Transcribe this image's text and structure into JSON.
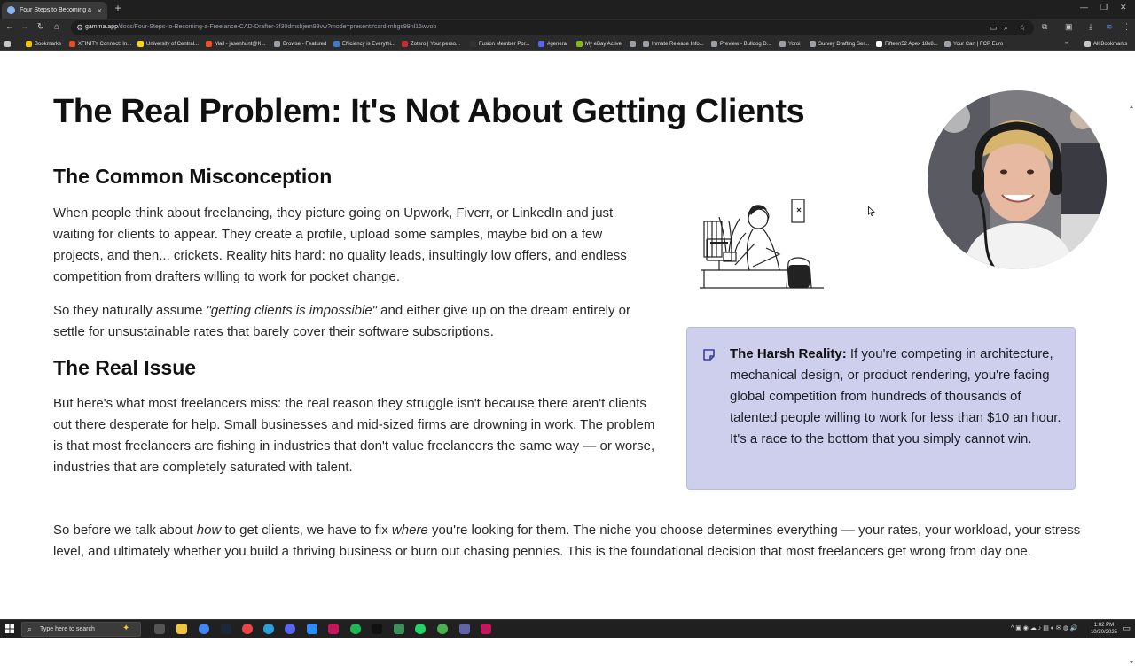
{
  "browser": {
    "tab_title": "Four Steps to Becoming a Freel",
    "tab_close": "×",
    "new_tab": "+",
    "url_host": "gamma.app",
    "url_path": "/docs/Four-Steps-to-Becoming-a-Freelance-CAD-Drafter-3f30dmsbjem93vw?mode=present#card-mhgs99nl16wvob",
    "all_bookmarks": "All Bookmarks",
    "bookmarks": [
      "Bookmarks",
      "XFINITY Connect: In...",
      "University of Central...",
      "Mail - jasenhunt@K...",
      "Browse - Featured",
      "Efficiency is Everythi...",
      "Zotero | Your perso...",
      "Fusion Member Por...",
      "#general",
      "My eBay Active",
      "Inmate Release Info...",
      "Preview - Bulldog D...",
      "Yoroi",
      "Survey Drafting Ser...",
      "Fifteen52 Apex 18x8...",
      "Your Cart | FCP Euro"
    ]
  },
  "page": {
    "title": "The Real Problem: It's Not About Getting Clients",
    "section1_heading": "The Common Misconception",
    "section1_p1": "When people think about freelancing, they picture going on Upwork, Fiverr, or LinkedIn and just waiting for clients to appear. They create a profile, upload some samples, maybe bid on a few projects, and then... crickets. Reality hits hard: no quality leads, insultingly low offers, and endless competition from drafters willing to work for pocket change.",
    "section1_p2_before": "So they naturally assume ",
    "section1_p2_emph": "\"getting clients is impossible\"",
    "section1_p2_after": " and either give up on the dream entirely or settle for unsustainable rates that barely cover their software subscriptions.",
    "section2_heading": "The Real Issue",
    "section2_p1": "But here's what most freelancers miss: the real reason they struggle isn't because there aren't clients out there desperate for help. Small businesses and mid-sized firms are drowning in work. The problem is that most freelancers are fishing in industries that don't value freelancers the same way — or worse, industries that are completely saturated with talent.",
    "callout_label": "The Harsh Reality:",
    "callout_text": " If you're competing in architecture, mechanical design, or product rendering, you're facing global competition from hundreds of thousands of talented people willing to work for less than $10 an hour. It's a race to the bottom that you simply cannot win.",
    "closing_a": "So before we talk about ",
    "closing_b": "how",
    "closing_c": " to get clients, we have to fix ",
    "closing_d": "where",
    "closing_e": " you're looking for them. The niche you choose determines everything — your rates, your workload, your stress level, and ultimately whether you build a thriving business or burn out chasing pennies. This is the foundational decision that most freelancers get wrong from day one."
  },
  "taskbar": {
    "search_placeholder": "Type here to search",
    "time": "1:02 PM",
    "date": "10/30/2025"
  },
  "colors": {
    "callout_bg": "#cdcfec",
    "callout_icon": "#3b3f9e"
  }
}
